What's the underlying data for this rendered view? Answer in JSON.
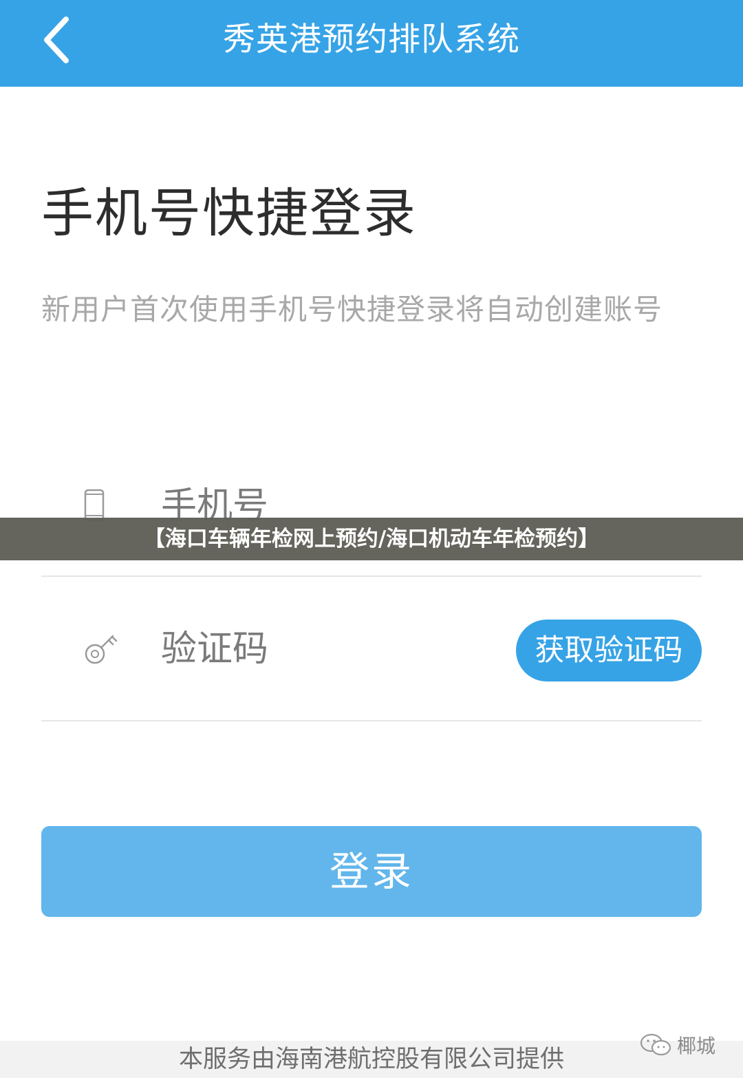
{
  "header": {
    "title": "秀英港预约排队系统",
    "back_icon": "chevron-left-icon"
  },
  "login": {
    "title": "手机号快捷登录",
    "subtitle": "新用户首次使用手机号快捷登录将自动创建账号",
    "phone_placeholder": "手机号",
    "phone_icon": "phone-icon",
    "code_placeholder": "验证码",
    "code_icon": "key-icon",
    "get_code_label": "获取验证码",
    "submit_label": "登录"
  },
  "footer": {
    "text": "本服务由海南港航控股有限公司提供"
  },
  "overlay": {
    "caption": "【海口车辆年检网上预约/海口机动车年检预约】"
  },
  "watermark": {
    "label": "椰城",
    "icon": "wechat-icon"
  },
  "colors": {
    "primary": "#36a3e6",
    "login_button": "#62b6eb",
    "banner_bg": "#5f5e56",
    "subtitle_text": "#a8a8a8"
  }
}
